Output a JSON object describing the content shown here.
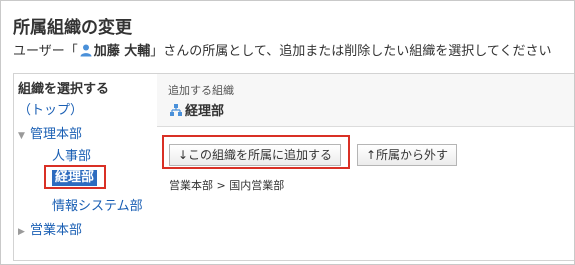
{
  "page": {
    "title": "所属組織の変更",
    "desc_prefix": "ユーザー「",
    "user_name": "加藤 大輔",
    "desc_suffix": "」さんの所属として、追加または削除したい組織を選択してください"
  },
  "left": {
    "heading": "組織を選択する",
    "items": [
      {
        "label": "（トップ）"
      },
      {
        "label": "管理本部"
      },
      {
        "label": "人事部"
      },
      {
        "label": "経理部"
      },
      {
        "label": "情報システム部"
      },
      {
        "label": "営業本部"
      }
    ]
  },
  "right": {
    "add_label": "追加する組織",
    "org_name": "経理部",
    "add_button": "↓この組織を所属に追加する",
    "remove_button": "↑所属から外す",
    "current_membership": "営業本部 > 国内営業部"
  },
  "colors": {
    "accent_red": "#d93025",
    "link": "#1a5fb4",
    "selected_bg": "#2d6bbf"
  }
}
